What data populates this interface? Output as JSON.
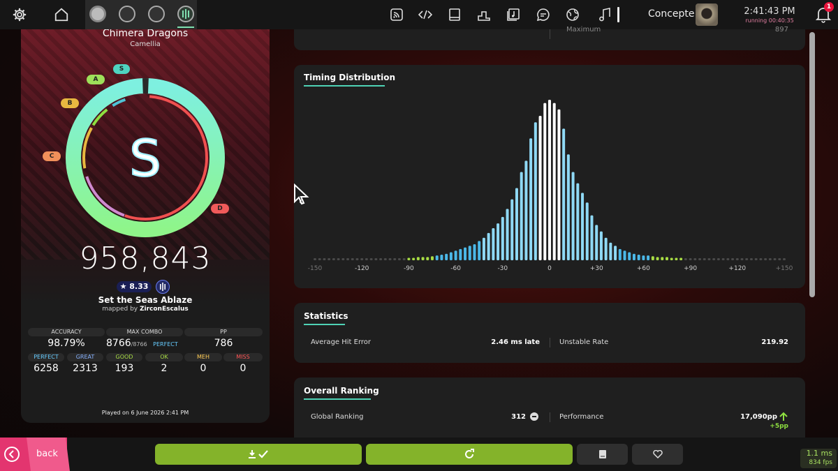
{
  "topbar": {
    "user_name": "Concepte",
    "clock": "2:41:43 PM",
    "running": "running 00:40:35",
    "notification_count": "1"
  },
  "beatmap": {
    "title": "Chimera Dragons",
    "artist": "Camellia",
    "difficulty": "Set the Seas Ablaze",
    "mapper_prefix": "mapped by",
    "mapper": "ZirconEscalus",
    "star_rating": "★ 8.33"
  },
  "result": {
    "grade": "S",
    "score": "958,843",
    "grade_pills": [
      "S",
      "A",
      "B",
      "C",
      "D"
    ],
    "stats": [
      {
        "label": "ACCURACY",
        "value": "98.79%"
      },
      {
        "label": "MAX COMBO",
        "value": "8766",
        "suffix": "/8766",
        "tag": "PERFECT"
      },
      {
        "label": "PP",
        "value": "786"
      }
    ],
    "judgements": [
      {
        "label": "PERFECT",
        "value": "6258",
        "color": "#66ccff"
      },
      {
        "label": "GREAT",
        "value": "2313",
        "color": "#88b3ff"
      },
      {
        "label": "GOOD",
        "value": "193",
        "color": "#a8dd44"
      },
      {
        "label": "OK",
        "value": "2",
        "color": "#a8dd44"
      },
      {
        "label": "MEH",
        "value": "0",
        "color": "#ffcc55"
      },
      {
        "label": "MISS",
        "value": "0",
        "color": "#ff5555"
      }
    ],
    "played_on": "Played on 6 June 2026 2:41 PM"
  },
  "partial_card": {
    "label": "Maximum",
    "value": "897"
  },
  "timing": {
    "title": "Timing Distribution",
    "x_ticks": [
      "-150",
      "-120",
      "-90",
      "-60",
      "-30",
      "0",
      "+30",
      "+60",
      "+90",
      "+120",
      "+150"
    ]
  },
  "chart_data": {
    "type": "bar",
    "title": "Timing Distribution",
    "x_range": [
      -150,
      150
    ],
    "bin_width_ms": 3,
    "x_ticks": [
      -150,
      -120,
      -90,
      -60,
      -30,
      0,
      30,
      60,
      90,
      120,
      150
    ],
    "y_scale": "relative (0-1)",
    "series": [
      {
        "name": "",
        "note": "early/late counts per 3 ms bin, relative height"
      }
    ],
    "x": [
      -150,
      -147,
      -144,
      -141,
      -138,
      -135,
      -132,
      -129,
      -126,
      -123,
      -120,
      -117,
      -114,
      -111,
      -108,
      -105,
      -102,
      -99,
      -96,
      -93,
      -90,
      -87,
      -84,
      -81,
      -78,
      -75,
      -72,
      -69,
      -66,
      -63,
      -60,
      -57,
      -54,
      -51,
      -48,
      -45,
      -42,
      -39,
      -36,
      -33,
      -30,
      -27,
      -24,
      -21,
      -18,
      -15,
      -12,
      -9,
      -6,
      -3,
      0,
      3,
      6,
      9,
      12,
      15,
      18,
      21,
      24,
      27,
      30,
      33,
      36,
      39,
      42,
      45,
      48,
      51,
      54,
      57,
      60,
      63,
      66,
      69,
      72,
      75,
      78,
      81,
      84,
      87,
      90,
      93,
      96,
      99,
      102,
      105,
      108,
      111,
      114,
      117,
      120,
      123,
      126,
      129,
      132,
      135,
      138,
      141,
      144,
      147,
      150
    ],
    "values": [
      0.01,
      0.01,
      0.01,
      0.01,
      0.01,
      0.01,
      0.01,
      0.01,
      0.01,
      0.01,
      0.01,
      0.01,
      0.01,
      0.01,
      0.01,
      0.01,
      0.01,
      0.01,
      0.01,
      0.01,
      0.015,
      0.015,
      0.02,
      0.02,
      0.02,
      0.025,
      0.03,
      0.035,
      0.04,
      0.05,
      0.06,
      0.07,
      0.08,
      0.09,
      0.1,
      0.12,
      0.14,
      0.17,
      0.2,
      0.23,
      0.27,
      0.32,
      0.38,
      0.45,
      0.55,
      0.62,
      0.76,
      0.86,
      0.9,
      0.98,
      1.0,
      0.98,
      0.94,
      0.82,
      0.66,
      0.55,
      0.48,
      0.42,
      0.36,
      0.28,
      0.22,
      0.18,
      0.14,
      0.11,
      0.09,
      0.07,
      0.06,
      0.05,
      0.04,
      0.035,
      0.03,
      0.03,
      0.025,
      0.02,
      0.02,
      0.02,
      0.015,
      0.015,
      0.015,
      0.01,
      0.01,
      0.01,
      0.01,
      0.01,
      0.01,
      0.01,
      0.01,
      0.01,
      0.01,
      0.01,
      0.01,
      0.01,
      0.01,
      0.01,
      0.01,
      0.01,
      0.01,
      0.01,
      0.01,
      0.01,
      0.01
    ]
  },
  "statistics": {
    "title": "Statistics",
    "rows": [
      {
        "label": "Average Hit Error",
        "value": "2.46 ms late"
      },
      {
        "label": "Unstable Rate",
        "value": "219.92"
      }
    ]
  },
  "ranking": {
    "title": "Overall Ranking",
    "rows": [
      {
        "label": "Global Ranking",
        "value": "312"
      },
      {
        "label": "Performance",
        "value": "17,090pp",
        "delta": "+5pp"
      }
    ]
  },
  "bottom": {
    "back_label": "back",
    "fps_ms": "1.1 ms",
    "fps": "834 fps"
  },
  "colors": {
    "accent_green": "#84b32a",
    "back_pink": "#e3356f",
    "ring_cyan": "#7ef0e0",
    "ring_red": "#f05050"
  }
}
